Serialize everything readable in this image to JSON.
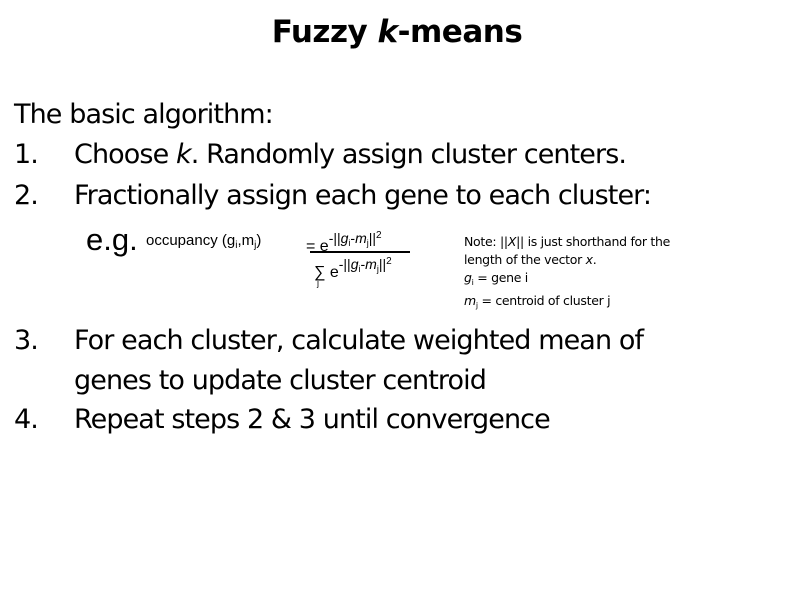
{
  "slide": {
    "title_prefix": "Fuzzy ",
    "title_k": "k",
    "title_suffix": "-means",
    "intro": "The basic algorithm:",
    "steps": [
      {
        "num": "1.",
        "text_a": "Choose ",
        "text_k": "k",
        "text_b": ".  Randomly assign cluster centers."
      },
      {
        "num": "2.",
        "text": "Fractionally assign each gene to each cluster:"
      },
      {
        "num": "3.",
        "line1": "For each cluster, calculate weighted mean of",
        "line2": "genes to update cluster centroid"
      },
      {
        "num": "4.",
        "text": "Repeat steps 2 & 3 until convergence"
      }
    ],
    "formula": {
      "eg": "e.g.",
      "occupancy_label": "occupancy (g",
      "occupancy_sub_i": "i",
      "occupancy_mid": ",m",
      "occupancy_sub_j": "j",
      "occupancy_end": ")",
      "equals": "= e",
      "exp_prefix": "-||",
      "exp_g": "g",
      "exp_sub_i": "i",
      "exp_minus": "-",
      "exp_m": "m",
      "exp_sub_j": "j",
      "exp_norm": "||",
      "exp_sup": "2",
      "sigma": "∑",
      "sigma_sub": "j",
      "denom_e": " e"
    },
    "note": {
      "line1_a": "Note:  ||",
      "line1_x": "X",
      "line1_b": "||  is just shorthand for the",
      "line2_a": "length of the vector ",
      "line2_x": "x",
      "line2_b": ".",
      "line3_g": "g",
      "line3_sub": "i",
      "line3_rest": " = gene i",
      "line4_m": "m",
      "line4_sub": "j",
      "line4_rest": " = centroid of cluster j"
    }
  }
}
